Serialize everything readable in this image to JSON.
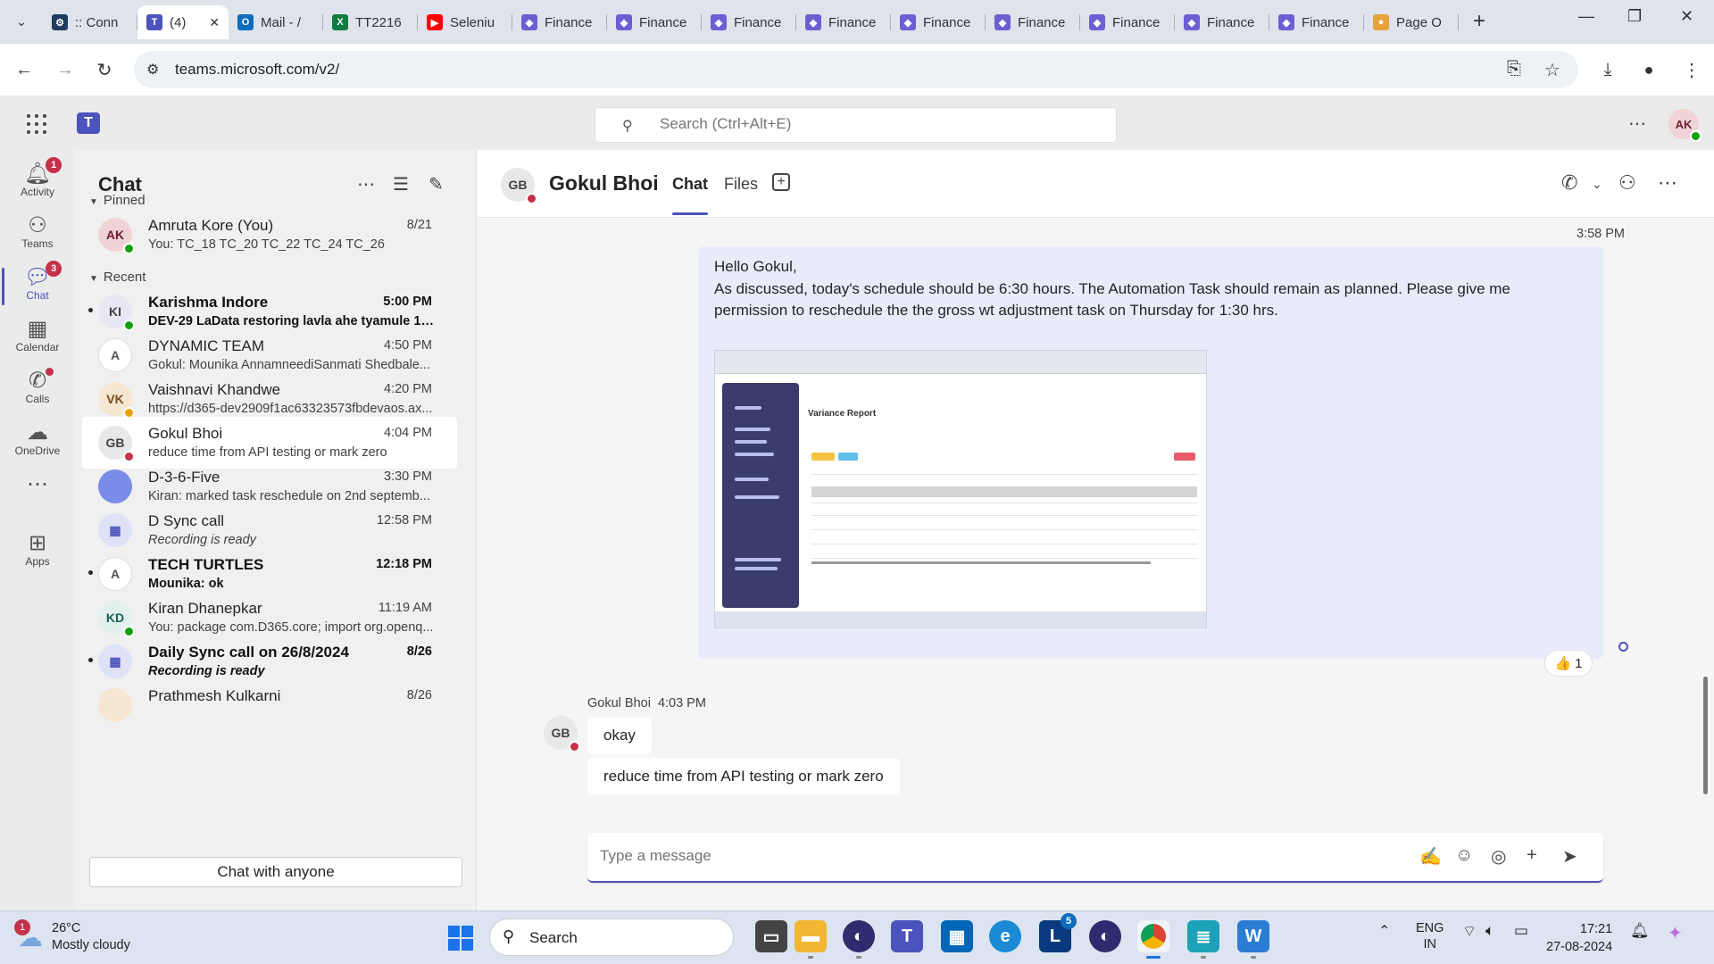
{
  "browser": {
    "tabs": [
      {
        "label": ":: Conn",
        "icon": "settings-icon",
        "color": "#1f3a5f"
      },
      {
        "label": "(4)",
        "icon": "teams-icon",
        "color": "#4b53bc",
        "active": true
      },
      {
        "label": "Mail - /",
        "icon": "outlook-icon",
        "color": "#0f6cbd"
      },
      {
        "label": "TT2216",
        "icon": "excel-icon",
        "color": "#107c41"
      },
      {
        "label": "Seleniu",
        "icon": "youtube-icon",
        "color": "#ff0000"
      },
      {
        "label": "Finance",
        "icon": "dynamics-icon",
        "color": "#6b5fd3"
      },
      {
        "label": "Finance",
        "icon": "dynamics-icon",
        "color": "#6b5fd3"
      },
      {
        "label": "Finance",
        "icon": "dynamics-icon",
        "color": "#6b5fd3"
      },
      {
        "label": "Finance",
        "icon": "dynamics-icon",
        "color": "#6b5fd3"
      },
      {
        "label": "Finance",
        "icon": "dynamics-icon",
        "color": "#6b5fd3"
      },
      {
        "label": "Finance",
        "icon": "dynamics-icon",
        "color": "#6b5fd3"
      },
      {
        "label": "Finance",
        "icon": "dynamics-icon",
        "color": "#6b5fd3"
      },
      {
        "label": "Finance",
        "icon": "dynamics-icon",
        "color": "#6b5fd3"
      },
      {
        "label": "Finance",
        "icon": "dynamics-icon",
        "color": "#6b5fd3"
      },
      {
        "label": "Page O",
        "icon": "chrome-icon",
        "color": "#e8a33d"
      }
    ],
    "url": "teams.microsoft.com/v2/"
  },
  "teams": {
    "search_placeholder": "Search (Ctrl+Alt+E)",
    "user_initials": "AK",
    "accent": "#4b53bc"
  },
  "rail": [
    {
      "label": "Activity",
      "icon": "bell-icon",
      "badge": "1"
    },
    {
      "label": "Teams",
      "icon": "teams-people-icon"
    },
    {
      "label": "Chat",
      "icon": "chat-icon",
      "badge": "3",
      "active": true
    },
    {
      "label": "Calendar",
      "icon": "calendar-icon"
    },
    {
      "label": "Calls",
      "icon": "phone-icon",
      "dot": true
    },
    {
      "label": "OneDrive",
      "icon": "cloud-icon"
    },
    {
      "label": "",
      "icon": "more-icon"
    },
    {
      "label": "Apps",
      "icon": "plus-square-icon"
    }
  ],
  "chatlist": {
    "title": "Chat",
    "pinned_label": "Pinned",
    "recent_label": "Recent",
    "pinned": [
      {
        "initials": "AK",
        "name": "Amruta Kore (You)",
        "preview": "You: TC_18 TC_20 TC_22 TC_24 TC_26",
        "time": "8/21",
        "avatar_bg": "#f0d3d6",
        "avatar_fg": "#6b1f2b",
        "status": "green"
      }
    ],
    "recent": [
      {
        "initials": "KI",
        "name": "Karishma Indore",
        "preview": "DEV-29 LaData restoring lavla ahe tyamule 1h...",
        "time": "5:00 PM",
        "unread": true,
        "avatar_bg": "#e8e8f5",
        "avatar_fg": "#444",
        "status": "green"
      },
      {
        "initials": "A",
        "name": "DYNAMIC TEAM",
        "preview": "Gokul: Mounika AnnamneediSanmati Shedbale...",
        "time": "4:50 PM",
        "group": true
      },
      {
        "initials": "VK",
        "name": "Vaishnavi Khandwe",
        "preview": "https://d365-dev2909f1ac63323573fbdevaos.ax...",
        "time": "4:20 PM",
        "avatar_bg": "#f6e6d2",
        "avatar_fg": "#7a4a1a",
        "status": "yellow"
      },
      {
        "initials": "GB",
        "name": "Gokul Bhoi",
        "preview": "reduce time from API testing or mark zero",
        "time": "4:04 PM",
        "selected": true,
        "avatar_bg": "#e8e8e8",
        "avatar_fg": "#444",
        "status": "red"
      },
      {
        "initials": "",
        "name": "D-3-6-Five",
        "preview": "Kiran: marked task reschedule on 2nd septemb...",
        "time": "3:30 PM",
        "avatar_bg": "#7b8ce8",
        "avatar_fg": "#fff"
      },
      {
        "initials": "",
        "name": "D Sync call",
        "preview": "Recording is ready",
        "time": "12:58 PM",
        "meeting": true,
        "italic": true
      },
      {
        "initials": "A",
        "name": "TECH TURTLES",
        "preview": "Mounika: ok",
        "time": "12:18 PM",
        "unread": true,
        "group": true
      },
      {
        "initials": "KD",
        "name": "Kiran Dhanepkar",
        "preview": "You: package com.D365.core; import org.openq...",
        "time": "11:19 AM",
        "avatar_bg": "#e2f0ee",
        "avatar_fg": "#1b5e55",
        "status": "green"
      },
      {
        "initials": "",
        "name": "Daily Sync call on 26/8/2024",
        "preview": "Recording is ready",
        "time": "8/26",
        "unread": true,
        "meeting": true,
        "italic": true
      },
      {
        "initials": "",
        "name": "Prathmesh Kulkarni",
        "preview": "",
        "time": "8/26",
        "avatar_bg": "#f6e6d2",
        "avatar_fg": "#7a4a1a"
      }
    ],
    "chat_with_anyone": "Chat with anyone"
  },
  "conversation": {
    "contact_initials": "GB",
    "contact_name": "Gokul Bhoi",
    "tabs": [
      "Chat",
      "Files"
    ],
    "my_message": {
      "time": "3:58 PM",
      "line1": "Hello Gokul,",
      "line2": "As discussed, today's schedule should be 6:30 hours. The Automation Task should remain as planned. Please give me",
      "line3": "permission to reschedule the the gross wt adjustment task on Thursday for 1:30 hrs.",
      "attachment_title": "Variance Report",
      "reaction_emoji": "👍",
      "reaction_count": "1"
    },
    "reply": {
      "sender": "Gokul Bhoi",
      "time": "4:03 PM",
      "messages": [
        "okay",
        "reduce time from API testing or mark zero"
      ]
    },
    "composer_placeholder": "Type a message"
  },
  "taskbar": {
    "temp": "26°C",
    "weather": "Mostly cloudy",
    "weather_badge": "1",
    "search_label": "Search",
    "lang1": "ENG",
    "lang2": "IN",
    "time": "17:21",
    "date": "27-08-2024",
    "l_badge": "5"
  }
}
